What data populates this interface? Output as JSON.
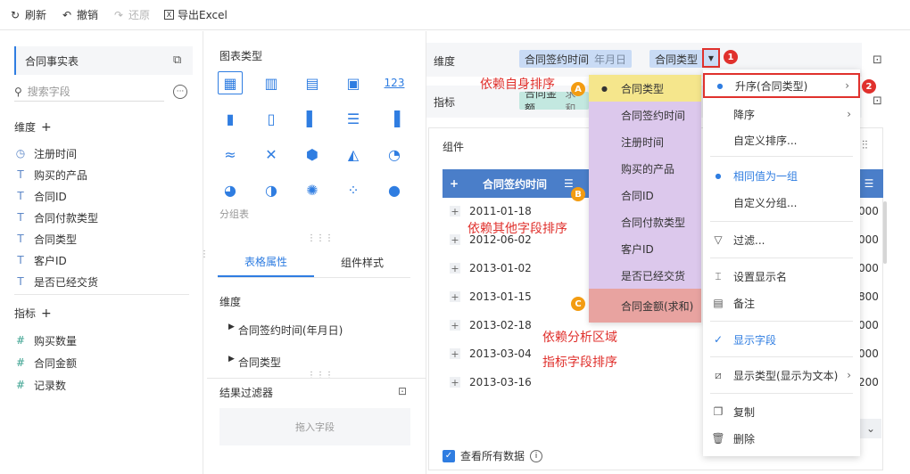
{
  "toolbar": {
    "refresh": "刷新",
    "undo": "撤销",
    "redo": "还原",
    "export": "导出Excel"
  },
  "left": {
    "table_name": "合同事实表",
    "search_placeholder": "搜索字段",
    "dim_title": "维度",
    "dims": [
      "注册时间",
      "购买的产品",
      "合同ID",
      "合同付款类型",
      "合同类型",
      "客户ID",
      "是否已经交货"
    ],
    "measure_title": "指标",
    "measures": [
      "购买数量",
      "合同金额",
      "记录数"
    ]
  },
  "mid": {
    "chart_type_title": "图表类型",
    "group_table": "分组表",
    "tab_table_props": "表格属性",
    "tab_component_style": "组件样式",
    "dim_section": "维度",
    "dim_items": [
      "合同签约时间(年月日)",
      "合同类型"
    ],
    "filter_title": "结果过滤器",
    "drop_field": "拖入字段"
  },
  "right": {
    "dim_label": "维度",
    "measure_label": "指标",
    "pill_time": "合同签约时间",
    "pill_time_sub": "年月日",
    "pill_type": "合同类型",
    "pill_amount": "合同金额",
    "pill_amount_sub": "求和",
    "component_label": "组件",
    "header_col": "合同签约时间",
    "dates": [
      "2011-01-18",
      "2012-06-02",
      "2013-01-02",
      "2013-01-15",
      "2013-02-18",
      "2013-03-04",
      "2013-03-16"
    ],
    "right_vals": [
      "000",
      "000",
      "000",
      "800",
      "000",
      "000",
      "200"
    ],
    "view_all": "查看所有数据"
  },
  "annotations": {
    "self_sort": "依赖自身排序",
    "other_field_sort": "依赖其他字段排序",
    "analysis_area_1": "依赖分析区域",
    "analysis_area_2": "指标字段排序",
    "badge_a": "A",
    "badge_b": "B",
    "badge_c": "C",
    "badge_1": "1",
    "badge_2": "2"
  },
  "dropdown_list": [
    "合同类型",
    "合同签约时间",
    "注册时间",
    "购买的产品",
    "合同ID",
    "合同付款类型",
    "客户ID",
    "是否已经交货",
    "合同金额(求和)"
  ],
  "menu": {
    "asc": "升序(合同类型)",
    "desc": "降序",
    "custom_sort": "自定义排序...",
    "same_group": "相同值为一组",
    "custom_group": "自定义分组...",
    "filter": "过滤...",
    "set_display_name": "设置显示名",
    "note": "备注",
    "show_field": "显示字段",
    "display_type": "显示类型(显示为文本)",
    "copy": "复制",
    "delete": "删除"
  },
  "colors": {
    "accent": "#2f7de1",
    "highlight_red": "#e0312d",
    "list_purple": "#dcc8ec",
    "list_yellow": "#f5e68c",
    "list_pink": "#e8a3a0"
  }
}
